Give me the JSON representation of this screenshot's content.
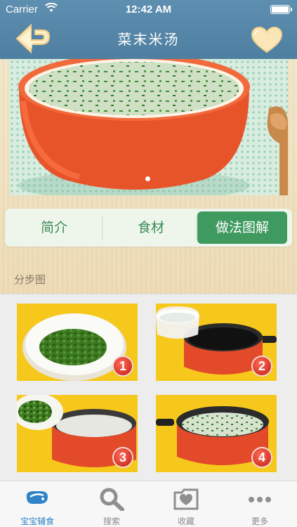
{
  "status_bar": {
    "carrier": "Carrier",
    "time": "12:42 AM"
  },
  "nav": {
    "title": "菜末米汤",
    "back_icon": "back-arrow-icon",
    "favorite_icon": "heart-icon"
  },
  "hero": {
    "page_indicator": {
      "current": 1,
      "total": 1
    }
  },
  "tabs": [
    {
      "label": "简介",
      "selected": false
    },
    {
      "label": "食材",
      "selected": false
    },
    {
      "label": "做法图解",
      "selected": true
    }
  ],
  "section": {
    "label": "分步图"
  },
  "steps": [
    {
      "number": "1"
    },
    {
      "number": "2"
    },
    {
      "number": "3"
    },
    {
      "number": "4"
    }
  ],
  "tabbar": {
    "items": [
      {
        "label": "宝宝辅食",
        "icon": "baby-food-icon",
        "active": true
      },
      {
        "label": "搜索",
        "icon": "search-icon",
        "active": false
      },
      {
        "label": "收藏",
        "icon": "favorites-box-icon",
        "active": false
      },
      {
        "label": "更多",
        "icon": "more-dots-icon",
        "active": false
      }
    ]
  },
  "colors": {
    "nav_bar": "#5a8aab",
    "tab_selected": "#3e9a5e",
    "tab_text": "#3c8a56",
    "tabbar_active": "#2f83c8",
    "step_badge": "#d22a1a"
  }
}
